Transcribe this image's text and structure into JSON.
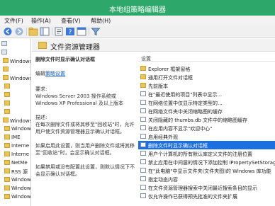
{
  "window": {
    "title": "本地组策略编辑器"
  },
  "menu": [
    "文件(F)",
    "操作(A)",
    "查看(V)",
    "帮助(H)"
  ],
  "toolbar": {
    "buttons": [
      "back-icon",
      "forward-icon",
      "up-icon",
      "show-hide-tree-icon",
      "refresh-icon",
      "export-icon",
      "help-icon",
      "properties-icon",
      "filter-icon"
    ]
  },
  "tree": {
    "items": [
      {
        "label": "",
        "icon": "policy"
      },
      {
        "label": "",
        "icon": "policy"
      },
      {
        "label": "Windows 设置",
        "icon": "folder"
      },
      {
        "label": "",
        "icon": "folder"
      },
      {
        "label": "Windows 设置",
        "icon": "folder"
      },
      {
        "label": "",
        "icon": "folder"
      },
      {
        "label": "",
        "icon": "folder"
      },
      {
        "label": "",
        "icon": "folder"
      },
      {
        "label": "",
        "icon": "folder"
      },
      {
        "label": "Windows \"启\"",
        "icon": "folder"
      },
      {
        "label": "Windows",
        "icon": "folder"
      },
      {
        "label": "IME",
        "icon": "folder"
      },
      {
        "label": "Interne",
        "icon": "folder"
      },
      {
        "label": "Interne",
        "icon": "folder"
      },
      {
        "label": "NetMe",
        "icon": "folder"
      },
      {
        "label": "RSS 源",
        "icon": "folder"
      },
      {
        "label": "Window",
        "icon": "folder"
      },
      {
        "label": "Window",
        "icon": "folder"
      },
      {
        "label": "Window",
        "icon": "folder"
      }
    ]
  },
  "main": {
    "header": "文件资源管理器",
    "description": {
      "title": "删除文件时显示确认对话框",
      "edit_label": "编辑",
      "edit_link": "策略设置",
      "requirements_label": "要求:",
      "requirements_lines": [
        "Windows Server 2003 操作系统或",
        "Windows XP Professional 及以上版本"
      ],
      "desc_label": "描述:",
      "desc_lines": [
        "在每次删除文件或将其移至\"回收站\"时，允许",
        "用户使文件资源管理器显示确认对话框。",
        "",
        "如果启用此设置，则当用户删除文件或将其移",
        "至\"回收站\"时，会显示确认对话框。",
        "",
        "如果禁用或没有配置此设置，则默认情况下不",
        "会显示确认对话框。"
      ]
    },
    "list": {
      "column_header": "设置",
      "rows": [
        {
          "label": "Explorer 框架窗格",
          "icon": "folder"
        },
        {
          "label": "通用打开文件对话框",
          "icon": "folder"
        },
        {
          "label": "先前版本",
          "icon": "folder"
        },
        {
          "label": "在\"最近使用的项目\"列表中显示...",
          "icon": "policy"
        },
        {
          "label": "在网络位置中仅显示特定类型的...",
          "icon": "policy"
        },
        {
          "label": "在网络文件夹中关闭缩略图的缓存",
          "icon": "policy"
        },
        {
          "label": "关闭隐藏的 thumbs.db 文件中的缩略图缓存",
          "icon": "policy"
        },
        {
          "label": "在应用内容不显示\"欢迎中心\"",
          "icon": "policy"
        },
        {
          "label": "启用经典外观",
          "icon": "policy"
        },
        {
          "label": "删除文件时显示确认对话框",
          "icon": "policy",
          "selected": true
        },
        {
          "label": "用户个计算机的所有默认库定义文件的注册位置",
          "icon": "policy"
        },
        {
          "label": "禁止应用在中间层的情况下添加控制 IPropertySetStorage",
          "icon": "policy"
        },
        {
          "label": "在\"此电脑\"中显示文件夹(文件夹图)的 Windows 库功能",
          "icon": "policy"
        },
        {
          "label": "指定动态内容",
          "icon": "policy"
        },
        {
          "label": "在文件资源管理器搜索中关闭最近搜索条目的显示",
          "icon": "policy"
        },
        {
          "label": "仅允许操作已获得预先批准的文件夹扩展",
          "icon": "policy"
        }
      ]
    }
  },
  "colors": {
    "titlebar": "#2ea86a",
    "selection": "#1c6fe0",
    "link": "#1a5fb4"
  }
}
